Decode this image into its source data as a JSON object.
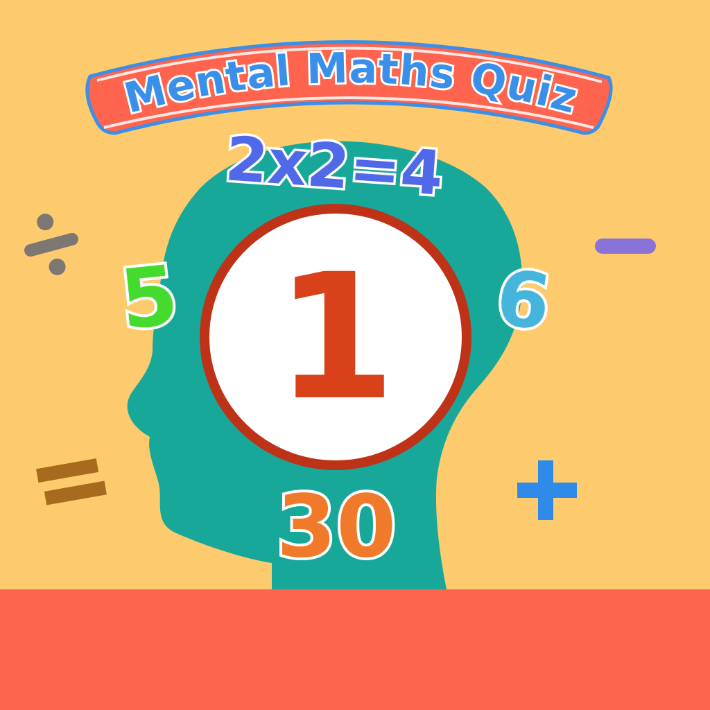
{
  "title": "Mental Maths Quiz",
  "equation": "2x2=4",
  "badge_number": "1",
  "floating_numbers": {
    "left": "5",
    "right": "6",
    "bottom": "30"
  },
  "math_symbols": {
    "divide": "÷",
    "minus": "−",
    "equals": "=",
    "plus": "+"
  },
  "colors": {
    "background": "#FDCB6E",
    "ground": "#FF644E",
    "head": "#18A89A",
    "title_banner": "#FF644E",
    "title_text": "#3A8FE8",
    "equation": "#4F69E8",
    "badge_ring": "#BE3218",
    "badge_number": "#D84119",
    "five": "#45DB2E",
    "six": "#45B5DC",
    "thirty": "#F0792A",
    "divide_symbol": "#7D7773",
    "minus_symbol": "#8A73D8",
    "equals_symbol": "#A86A1C",
    "plus_symbol": "#2E8BEA"
  }
}
